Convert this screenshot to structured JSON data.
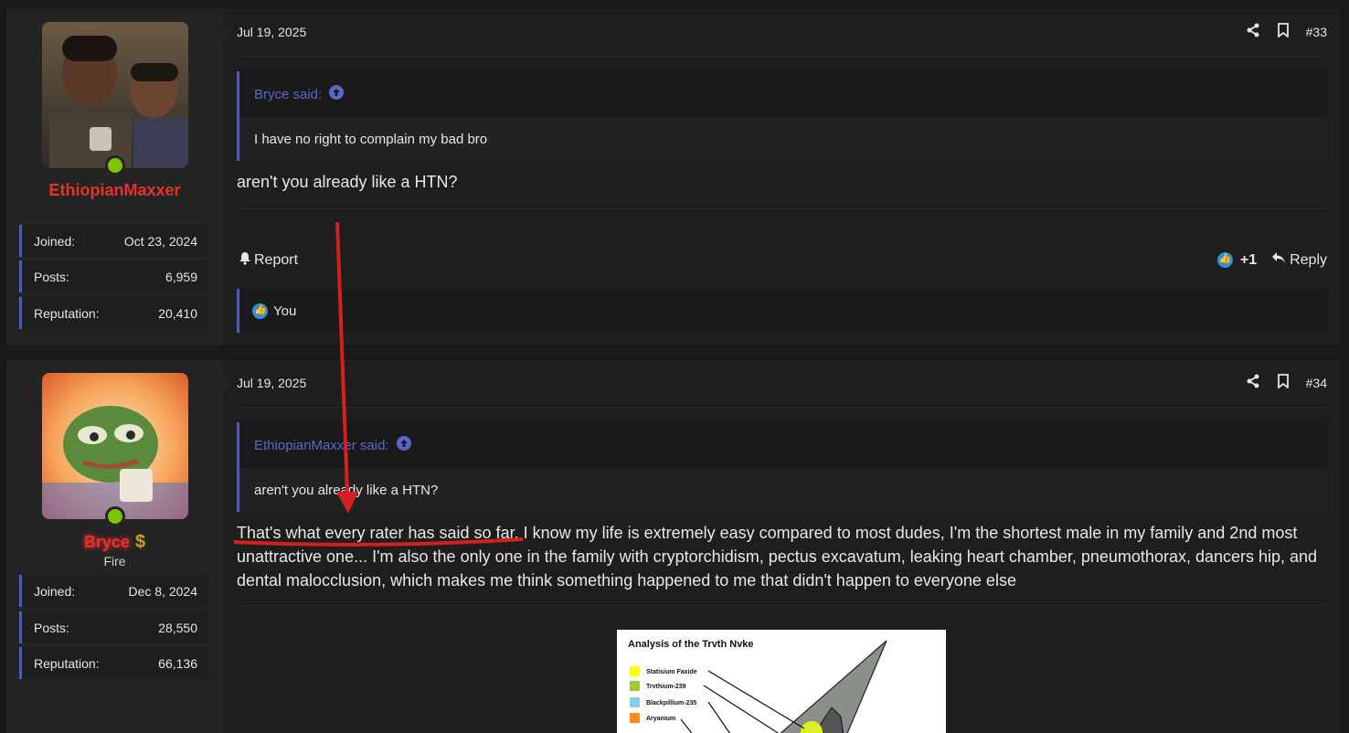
{
  "posts": [
    {
      "username": "EthiopianMaxxer",
      "user_title": "",
      "stats": [
        {
          "label": "Joined:",
          "value": "Oct 23, 2024"
        },
        {
          "label": "Posts:",
          "value": "6,959"
        },
        {
          "label": "Reputation:",
          "value": "20,410"
        }
      ],
      "date": "Jul 19, 2025",
      "post_number": "#33",
      "quote_author": "Bryce said:",
      "quote_text": "I have no right to complain my bad bro",
      "message": "aren't you already like a HTN?",
      "report_label": "Report",
      "reaction_count": "+1",
      "reply_label": "Reply",
      "liked_by": "You"
    },
    {
      "username": "Bryce",
      "user_badge": "$",
      "user_title": "Fire",
      "stats": [
        {
          "label": "Joined:",
          "value": "Dec 8, 2024"
        },
        {
          "label": "Posts:",
          "value": "28,550"
        },
        {
          "label": "Reputation:",
          "value": "66,136"
        }
      ],
      "date": "Jul 19, 2025",
      "post_number": "#34",
      "quote_author": "EthiopianMaxxer said:",
      "quote_text": "aren't you already like a HTN?",
      "message": "That's what every rater has said so far, I know my life is extremely easy compared to most dudes, I'm the shortest male in my family and 2nd most unattractive one... I'm also the only one in the family with cryptorchidism, pectus excavatum, leaking heart chamber, pneumothorax, dancers hip, and dental malocclusion, which makes me think something happened to me that didn't happen to everyone else",
      "embedded_image": {
        "title": "Analysis of the Trvth Nvke",
        "legend": [
          {
            "label": "Statisium Faxide",
            "color": "#ffff00"
          },
          {
            "label": "Trvthium-239",
            "color": "#9acd32"
          },
          {
            "label": "Blackpillium-235",
            "color": "#87ceeb"
          },
          {
            "label": "Aryanium",
            "color": "#ff8c1a"
          }
        ]
      }
    }
  ],
  "colors": {
    "background": "#1a1a1a",
    "accent": "#4b5db8",
    "username": "#e6322c",
    "online": "#7fc400",
    "annotation_arrow": "#d42020"
  }
}
